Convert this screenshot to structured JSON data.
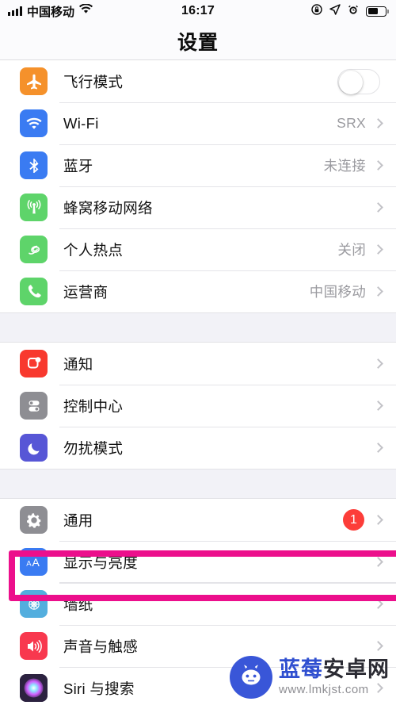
{
  "status_bar": {
    "carrier": "中国移动",
    "time": "16:17",
    "signal_icon": "signal-bars-icon",
    "wifi_icon": "wifi-icon",
    "rotation_lock_icon": "rotation-lock-icon",
    "location_icon": "location-arrow-icon",
    "alarm_icon": "alarm-clock-icon",
    "battery_icon": "battery-icon"
  },
  "header": {
    "title": "设置"
  },
  "groups": [
    {
      "rows": [
        {
          "label": "飞行模式",
          "value": "",
          "accessory": "toggle",
          "toggle_on": false,
          "icon": "airplane-icon",
          "icon_color": "#f5912b"
        },
        {
          "label": "Wi-Fi",
          "value": "SRX",
          "accessory": "chevron",
          "icon": "wifi-icon",
          "icon_color": "#3a7bf2"
        },
        {
          "label": "蓝牙",
          "value": "未连接",
          "accessory": "chevron",
          "icon": "bluetooth-icon",
          "icon_color": "#3a7bf2"
        },
        {
          "label": "蜂窝移动网络",
          "value": "",
          "accessory": "chevron",
          "icon": "cellular-antenna-icon",
          "icon_color": "#5ed46a"
        },
        {
          "label": "个人热点",
          "value": "关闭",
          "accessory": "chevron",
          "icon": "hotspot-link-icon",
          "icon_color": "#5ed46a"
        },
        {
          "label": "运营商",
          "value": "中国移动",
          "accessory": "chevron",
          "icon": "phone-icon",
          "icon_color": "#5ed46a"
        }
      ]
    },
    {
      "rows": [
        {
          "label": "通知",
          "value": "",
          "accessory": "chevron",
          "icon": "notification-icon",
          "icon_color": "#f8392e"
        },
        {
          "label": "控制中心",
          "value": "",
          "accessory": "chevron",
          "icon": "control-center-icon",
          "icon_color": "#8e8e93"
        },
        {
          "label": "勿扰模式",
          "value": "",
          "accessory": "chevron",
          "icon": "moon-icon",
          "icon_color": "#5756d6"
        }
      ]
    },
    {
      "rows": [
        {
          "label": "通用",
          "value": "",
          "accessory": "badge",
          "badge": "1",
          "icon": "gear-icon",
          "icon_color": "#8e8e93"
        },
        {
          "label": "显示与亮度",
          "value": "",
          "accessory": "chevron",
          "icon": "display-brightness-aa-icon",
          "icon_color": "#3a7bf2",
          "highlighted": true
        },
        {
          "label": "墙纸",
          "value": "",
          "accessory": "chevron",
          "icon": "wallpaper-flower-icon",
          "icon_color": "#53aede"
        },
        {
          "label": "声音与触感",
          "value": "",
          "accessory": "chevron",
          "icon": "speaker-volume-icon",
          "icon_color": "#f8384e"
        },
        {
          "label": "Siri 与搜索",
          "value": "",
          "accessory": "chevron",
          "icon": "siri-orb-icon",
          "icon_color": "#2c2240"
        }
      ]
    }
  ],
  "highlight": {
    "color": "#ec0f8c",
    "target_label": "显示与亮度"
  },
  "watermark": {
    "brand_primary": "蓝莓",
    "brand_secondary": "安卓网",
    "url": "www.lmkjst.com",
    "logo_icon": "android-robot-icon"
  }
}
